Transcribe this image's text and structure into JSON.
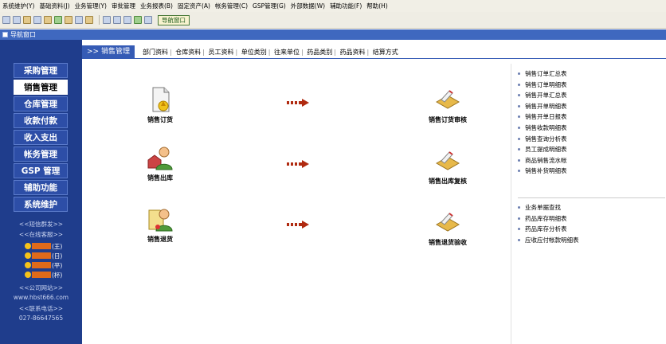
{
  "menubar": [
    "系统维护(Y)",
    "基础资料(J)",
    "业务管理(Y)",
    "审批管理",
    "业务报表(B)",
    "固定资产(A)",
    "帐务管理(C)",
    "GSP管理(G)",
    "外部数据(W)",
    "辅助功能(F)",
    "帮助(H)"
  ],
  "toolbar": {
    "nav_button": "导航窗口"
  },
  "window": {
    "title": "导航窗口"
  },
  "sidebar": {
    "items": [
      "采购管理",
      "销售管理",
      "仓库管理",
      "收款付款",
      "收入支出",
      "帐务管理",
      "GSP 管理",
      "辅助功能",
      "系统维护"
    ],
    "active_index": 1,
    "sms": "<<短信群发>>",
    "online": "<<在线客服>>",
    "qq": [
      "(王)",
      "(日)",
      "(平)",
      "(杯)"
    ],
    "website_label": "<<公司网站>>",
    "website": "www.hbst666.com",
    "phone_label": "<<联系电话>>",
    "phone": "027-86647565"
  },
  "tabs": {
    "active": ">> 销售管理",
    "items": [
      "部门资料",
      "仓库资料",
      "员工资料",
      "单位类别",
      "往来单位",
      "药品类别",
      "药品资料",
      "结算方式"
    ]
  },
  "workflow": {
    "row1": {
      "left": "销售订货",
      "right": "销售订货审核"
    },
    "row2": {
      "left": "销售出库",
      "right": "销售出库复核"
    },
    "row3": {
      "left": "销售退货",
      "right": "销售退货验收"
    }
  },
  "reports": {
    "group1": [
      "销售订单汇总表",
      "销售订单明细表",
      "销售开单汇总表",
      "销售开单明细表",
      "销售开单日报表",
      "销售收款明细表",
      "销售查询分析表",
      "员工提成明细表",
      "商品销售流水帐",
      "销售补货明细表"
    ],
    "group2": [
      "业务单据查找",
      "药品库存明细表",
      "药品库存分析表",
      "应收应付帐款明细表"
    ]
  },
  "colors": {
    "sidebar_bg": "#1f3d8c",
    "window_title": "#3f68bf",
    "tab_active": "#355bb5",
    "arrow": "#b02a10"
  }
}
